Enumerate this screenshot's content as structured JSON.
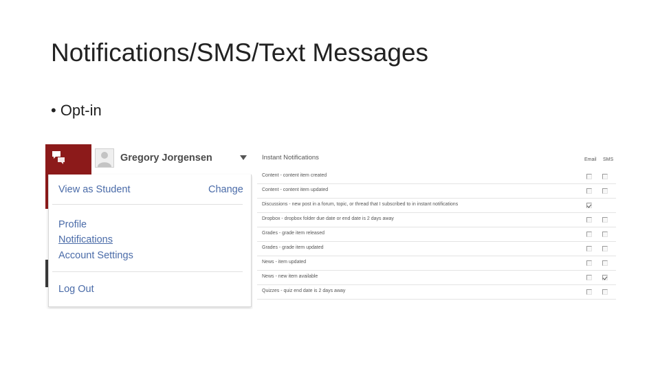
{
  "slide": {
    "title": "Notifications/SMS/Text Messages",
    "bullet": "• Opt-in"
  },
  "user_menu": {
    "user_name": "Gregory Jorgensen",
    "view_as_label": "View as Student",
    "change_label": "Change",
    "items": [
      "Profile",
      "Notifications",
      "Account Settings"
    ],
    "logout_label": "Log Out",
    "accent_color": "#8c1a1a",
    "link_color": "#4a6ba8"
  },
  "instant_notifications": {
    "title": "Instant Notifications",
    "columns": [
      "Email",
      "SMS"
    ],
    "rows": [
      {
        "label": "Content - content item created",
        "email": false,
        "sms": false
      },
      {
        "label": "Content - content item updated",
        "email": false,
        "sms": false
      },
      {
        "label": "Discussions - new post in a forum, topic, or thread that I subscribed to in instant notifications",
        "email": true,
        "sms": null
      },
      {
        "label": "Dropbox - dropbox folder due date or end date is 2 days away",
        "email": false,
        "sms": false
      },
      {
        "label": "Grades - grade item released",
        "email": false,
        "sms": false
      },
      {
        "label": "Grades - grade item updated",
        "email": false,
        "sms": false
      },
      {
        "label": "News - item updated",
        "email": false,
        "sms": false
      },
      {
        "label": "News - new item available",
        "email": false,
        "sms": true
      },
      {
        "label": "Quizzes - quiz end date is 2 days away",
        "email": false,
        "sms": false
      }
    ]
  }
}
